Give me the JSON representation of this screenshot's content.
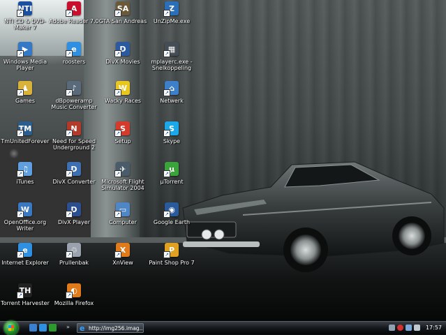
{
  "desktop": {
    "icons": [
      {
        "label": "NTI CD & DVD-Maker 7",
        "glyph": "NTI",
        "color": "#1b4fa0",
        "icon": "nti-cd-maker-icon"
      },
      {
        "label": "Adobe Reader 7.0",
        "glyph": "A",
        "color": "#c8102e",
        "icon": "adobe-reader-icon"
      },
      {
        "label": "GTA San Andreas",
        "glyph": "SA",
        "color": "#6b5a3a",
        "icon": "gta-san-andreas-icon"
      },
      {
        "label": "UnZipMe.exe",
        "glyph": "Z",
        "color": "#2a6fb8",
        "icon": "unzipme-icon"
      },
      {
        "label": "Windows Media Player",
        "glyph": "▶",
        "color": "#3478c6",
        "icon": "windows-media-player-icon"
      },
      {
        "label": "roosters",
        "glyph": "e",
        "color": "#2f8fe0",
        "icon": "internet-shortcut-icon"
      },
      {
        "label": "DivX Movies",
        "glyph": "D",
        "color": "#2c5aa0",
        "icon": "divx-movies-icon"
      },
      {
        "label": "mplayerc.exe - Snelkoppeling",
        "glyph": "▦",
        "color": "#444c55",
        "icon": "media-player-classic-icon"
      },
      {
        "label": "Games",
        "glyph": "♟",
        "color": "#d9b23a",
        "icon": "games-folder-icon"
      },
      {
        "label": "dBpoweramp Music Converter",
        "glyph": "♪",
        "color": "#5a6a7a",
        "icon": "dbpoweramp-icon"
      },
      {
        "label": "Wacky Races",
        "glyph": "W",
        "color": "#e8c81f",
        "icon": "wacky-races-icon"
      },
      {
        "label": "Netwerk",
        "glyph": "⌂",
        "color": "#3d7fc9",
        "icon": "network-icon"
      },
      {
        "label": "TmUnitedForever",
        "glyph": "TM",
        "color": "#2b5d8f",
        "icon": "trackmania-icon"
      },
      {
        "label": "Need for Speed Underground 2",
        "glyph": "N",
        "color": "#b33a2a",
        "icon": "need-for-speed-icon"
      },
      {
        "label": "Setup",
        "glyph": "S",
        "color": "#d43b2b",
        "icon": "setup-icon"
      },
      {
        "label": "Skype",
        "glyph": "S",
        "color": "#1ba8e8",
        "icon": "skype-icon"
      },
      {
        "label": "iTunes",
        "glyph": "♫",
        "color": "#5f9fe0",
        "icon": "itunes-icon"
      },
      {
        "label": "DivX Converter",
        "glyph": "D",
        "color": "#3e6fb0",
        "icon": "divx-converter-icon"
      },
      {
        "label": "Microsoft Flight Simulator 2004",
        "glyph": "✈",
        "color": "#4a5b6a",
        "icon": "flight-simulator-icon"
      },
      {
        "label": "µTorrent",
        "glyph": "µ",
        "color": "#3aa33a",
        "icon": "utorrent-icon"
      },
      {
        "label": "OpenOffice.org Writer",
        "glyph": "W",
        "color": "#3a78c2",
        "icon": "openoffice-writer-icon"
      },
      {
        "label": "DivX Player",
        "glyph": "D",
        "color": "#2c4f8f",
        "icon": "divx-player-icon"
      },
      {
        "label": "Computer",
        "glyph": "▭",
        "color": "#4f86c6",
        "icon": "computer-icon"
      },
      {
        "label": "Google Earth",
        "glyph": "◉",
        "color": "#2a5a9a",
        "icon": "google-earth-icon"
      },
      {
        "label": "Internet Explorer",
        "glyph": "e",
        "color": "#2f8fe0",
        "icon": "internet-explorer-icon"
      },
      {
        "label": "Prullenbak",
        "glyph": "♲",
        "color": "#9aa3ad",
        "icon": "recycle-bin-icon"
      },
      {
        "label": "XnView",
        "glyph": "X",
        "color": "#e07a1a",
        "icon": "xnview-icon"
      },
      {
        "label": "Paint Shop Pro 7",
        "glyph": "P",
        "color": "#e0a020",
        "icon": "paint-shop-pro-icon"
      },
      {
        "label": "Torrent Harvester",
        "glyph": "TH",
        "color": "#222222",
        "icon": "torrent-harvester-icon"
      },
      {
        "label": "Mozilla Firefox",
        "glyph": "◐",
        "color": "#e07a1a",
        "icon": "firefox-icon"
      }
    ]
  },
  "taskbar": {
    "start_icon": "windows-start-orb-icon",
    "quicklaunch": [
      {
        "icon": "show-desktop-icon",
        "color": "#3a7fd0"
      },
      {
        "icon": "internet-explorer-quicklaunch-icon",
        "color": "#2f8fe0"
      },
      {
        "icon": "utorrent-quicklaunch-icon",
        "color": "#2e9a2e"
      }
    ],
    "active_task": "http://img256.imag...",
    "tray_icons": [
      {
        "icon": "tray-arrow-icon",
        "color": "#8fa0b0"
      },
      {
        "icon": "security-alert-icon",
        "color": "#d03030"
      },
      {
        "icon": "network-tray-icon",
        "color": "#7aa8d8"
      },
      {
        "icon": "volume-icon",
        "color": "#c0c8d0"
      }
    ],
    "clock": "17:57"
  }
}
